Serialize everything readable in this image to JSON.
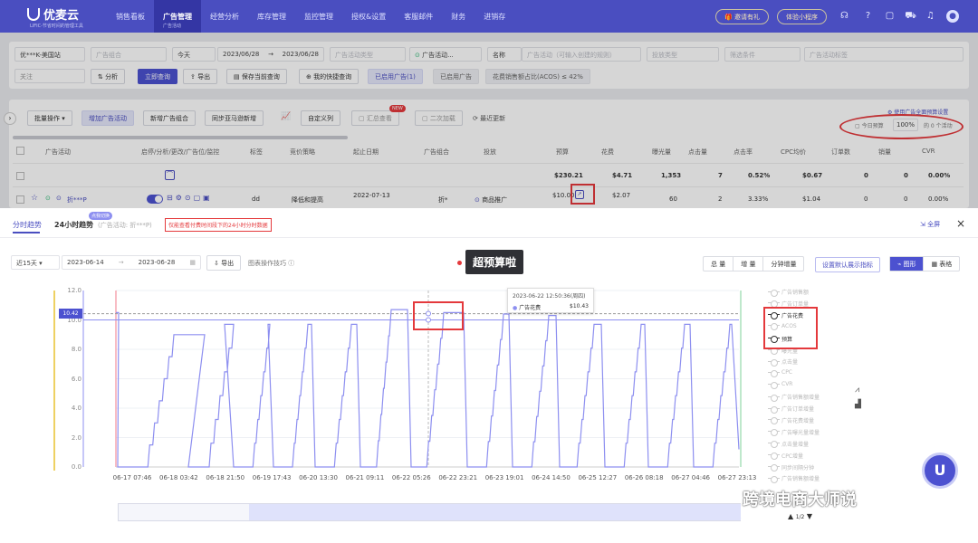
{
  "app": {
    "logo": "优麦云",
    "logo_sub": "LIFIC-节省时间的管理工具",
    "nav": [
      {
        "label": "销售看板",
        "active": false,
        "sub": ""
      },
      {
        "label": "广告管理",
        "active": true,
        "sub": "广告活动"
      },
      {
        "label": "经营分析",
        "active": false,
        "sub": ""
      },
      {
        "label": "库存管理",
        "active": false,
        "sub": ""
      },
      {
        "label": "监控管理",
        "active": false,
        "sub": ""
      },
      {
        "label": "授权&设置",
        "active": false,
        "sub": ""
      },
      {
        "label": "客服邮件",
        "active": false,
        "sub": ""
      },
      {
        "label": "财务",
        "active": false,
        "sub": ""
      },
      {
        "label": "进销存",
        "active": false,
        "sub": ""
      }
    ],
    "invite_label": "邀请有礼",
    "miniapp_label": "体验小程序"
  },
  "filters": {
    "shop": "优***K-美国站",
    "portfolio_ph": "广告组合",
    "date_preset": "今天",
    "date_from": "2023/06/28",
    "date_to": "2023/06/28",
    "campaign_type_ph": "广告活动类型",
    "campaign_status": "广告活动...",
    "name_label": "名称",
    "name_ph": "广告活动（可输入创建的规则）",
    "target_type_ph": "投放类型",
    "filter_cond_ph": "筛选条件",
    "campaign_tag_ph": "广告活动标签",
    "follow": "关注",
    "analyze_btn": "分析",
    "query_btn": "立即查询",
    "export_btn": "导出",
    "save_query_btn": "保存当前查询",
    "my_queries_btn": "我的快捷查询",
    "enabled_tag": "已启用广告(1)",
    "disabled_tag": "已启用广告",
    "acos_tag": "花费销售额占比(ACOS) ≤ 42%"
  },
  "toolbar": {
    "batch_btn": "批量操作",
    "add_campaign_btn": "增加广告活动",
    "add_portfolio_btn": "新增广告组合",
    "sync_btn": "同步亚马逊新增",
    "custom_cols_btn": "自定义列",
    "summary_toggle": "汇总查看",
    "new_badge": "NEW",
    "second_load": "二次加载",
    "recent_update": "最近更新",
    "budget_link": "使用广告全面预算设置",
    "today_budget_label": "今日预算",
    "budget_pct": "100%",
    "campaign_count_label": "的 0 个活动"
  },
  "table": {
    "headers": [
      "广告活动",
      "启停/分析/更改/广告位/监控",
      "标签",
      "竞价策略",
      "起止日期",
      "广告组合",
      "投放",
      "预算",
      "花费",
      "曝光量",
      "点击量",
      "点击率",
      "CPC均价",
      "订单数",
      "销量",
      "CVR"
    ],
    "summary": {
      "budget": "$230.21",
      "spend": "$4.71",
      "impressions": "1,353",
      "clicks": "7",
      "ctr": "0.52%",
      "cpc": "$0.67",
      "orders": "0",
      "units": "0",
      "cvr": "0.00%"
    },
    "row": {
      "name": "折***P",
      "tag": "dd",
      "bidding": "降低和提高",
      "start_date": "2022-07-13",
      "portfolio": "折*",
      "targeting": "商品推广",
      "budget": "$10.00",
      "spend": "$2.07",
      "impressions": "60",
      "clicks": "2",
      "ctr": "3.33%",
      "cpc": "$1.04",
      "orders": "0",
      "units": "0",
      "cvr": "0.00%"
    }
  },
  "panel": {
    "tab_intraday": "分时趋势",
    "tab_24h": "24小时趋势",
    "tab_badge": "点我切换",
    "campaign_ref": "(广告活动: 折***P)",
    "notice": "仅能查看付费时间段下的24小时分时数据",
    "fullscreen": "全屏",
    "range_preset": "近15天",
    "date_from": "2023-06-14",
    "date_to": "2023-06-28",
    "export": "导出",
    "tips": "图表操作技巧",
    "annotation": "超预算啦",
    "seg_total": "总 量",
    "seg_incr": "增 量",
    "seg_minute": "分钟增量",
    "set_default": "设置默认展示指标",
    "view_chart": "图形",
    "view_table": "表格",
    "pager": "1/2",
    "watermark": "跨境电商大师说"
  },
  "chart_data": {
    "type": "line",
    "ylim": [
      0,
      12
    ],
    "yticks": [
      "12.0",
      "10.0",
      "8.0",
      "6.0",
      "4.0",
      "2.0",
      "0.0"
    ],
    "x_tick_labels": [
      "06-17 07:46",
      "06-18 03:42",
      "06-18 21:50",
      "06-19 17:43",
      "06-20 13:30",
      "06-21 09:11",
      "06-22 05:26",
      "06-22 23:21",
      "06-23 19:01",
      "06-24 14:50",
      "06-25 12:27",
      "06-26 08:18",
      "06-27 04:46",
      "06-27 23:13"
    ],
    "budget_marker": "10.42",
    "tooltip": {
      "time": "2023-06-22 12:50:36(周四)",
      "series": "广告花费",
      "value": "$10.43"
    },
    "legend": [
      {
        "name": "广告销售额",
        "on": false
      },
      {
        "name": "广告订单量",
        "on": false
      },
      {
        "name": "广告花费",
        "on": true
      },
      {
        "name": "ACOS",
        "on": false
      },
      {
        "name": "预算",
        "on": true
      },
      {
        "name": "曝光量",
        "on": false
      },
      {
        "name": "点击量",
        "on": false
      },
      {
        "name": "CPC",
        "on": false
      },
      {
        "name": "CVR",
        "on": false
      },
      {
        "name": "广告销售额增量",
        "on": false
      },
      {
        "name": "广告订单增量",
        "on": false
      },
      {
        "name": "广告花费增量",
        "on": false
      },
      {
        "name": "广告曝光量增量",
        "on": false
      },
      {
        "name": "点击量增量",
        "on": false
      },
      {
        "name": "CPC增量",
        "on": false
      },
      {
        "name": "同步间隔分钟",
        "on": false
      },
      {
        "name": "广告销售额增量",
        "on": false
      }
    ],
    "series": [
      {
        "name": "广告花费",
        "color": "#8d8ff0"
      },
      {
        "name": "预算",
        "color": "#8d8ff0",
        "value": 10.0
      }
    ]
  }
}
